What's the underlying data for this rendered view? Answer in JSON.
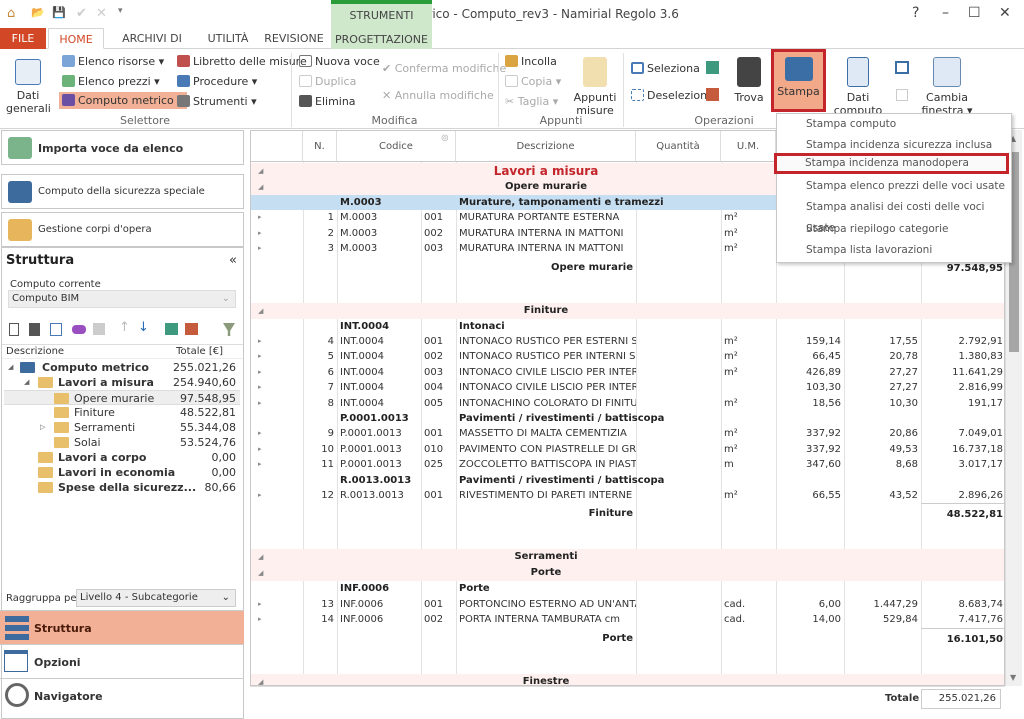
{
  "window": {
    "title": "Computo metrico - Computo_rev3 - Namirial Regolo 3.6",
    "help": "?",
    "minimize": "–",
    "maximize": "☐",
    "close": "✕"
  },
  "qat": {
    "home": "⌂",
    "open": "📂",
    "save": "💾",
    "check": "✔",
    "cancel": "✕",
    "more": "▾"
  },
  "tabs": {
    "file": "FILE",
    "home": "HOME",
    "archivi": "ARCHIVI DI BASE",
    "utilita": "UTILITÀ",
    "revisione": "REVISIONE",
    "context_group": "STRUMENTI",
    "progettazione": "PROGETTAZIONE"
  },
  "ribbon": {
    "dati_generali": "Dati generali",
    "elenco_risorse": "Elenco risorse",
    "elenco_prezzi": "Elenco prezzi",
    "computo_metrico": "Computo metrico",
    "libretto": "Libretto delle misure",
    "procedure": "Procedure",
    "strumenti": "Strumenti",
    "selettore": "Selettore",
    "nuova_voce": "Nuova voce",
    "duplica": "Duplica",
    "elimina": "Elimina",
    "conferma": "Conferma modifiche",
    "annulla": "Annulla modifiche",
    "modifica": "Modifica",
    "incolla": "Incolla",
    "copia": "Copia",
    "taglia": "Taglia",
    "appunti_misure": "Appunti misure",
    "appunti": "Appunti",
    "seleziona": "Seleziona",
    "deseleziona": "Deseleziona",
    "trova": "Trova",
    "stampa": "Stampa",
    "dati_computo": "Dati computo",
    "cambia_finestra": "Cambia finestra",
    "operazioni": "Operazioni",
    "accent": "#d24726",
    "highlight": "#c4252b"
  },
  "stampa_menu": [
    "Stampa computo",
    "Stampa incidenza sicurezza inclusa",
    "Stampa incidenza manodopera",
    "Stampa elenco prezzi delle voci usate",
    "Stampa analisi dei costi delle voci usate",
    "Stampa riepilogo categorie",
    "Stampa lista lavorazioni"
  ],
  "left": {
    "importa": "Importa voce da elenco",
    "sicurezza": "Computo della sicurezza speciale",
    "corpi": "Gestione corpi d'opera",
    "struttura_title": "Struttura",
    "collapse": "«",
    "computo_corrente_label": "Computo corrente",
    "computo_corrente_value": "Computo BIM",
    "tree_header": {
      "descr": "Descrizione",
      "totale": "Totale [€]"
    },
    "tree": [
      {
        "label": "Computo metrico",
        "value": "255.021,26",
        "level": 0,
        "bold": true,
        "exp": "◢"
      },
      {
        "label": "Lavori a misura",
        "value": "254.940,60",
        "level": 1,
        "bold": true,
        "exp": "◢"
      },
      {
        "label": "Opere murarie",
        "value": "97.548,95",
        "level": 2,
        "bold": false,
        "exp": "",
        "selected": true
      },
      {
        "label": "Finiture",
        "value": "48.522,81",
        "level": 2,
        "bold": false,
        "exp": ""
      },
      {
        "label": "Serramenti",
        "value": "55.344,08",
        "level": 2,
        "bold": false,
        "exp": "▷"
      },
      {
        "label": "Solai",
        "value": "53.524,76",
        "level": 2,
        "bold": false,
        "exp": ""
      },
      {
        "label": "Lavori a corpo",
        "value": "0,00",
        "level": 1,
        "bold": true,
        "exp": ""
      },
      {
        "label": "Lavori in economia",
        "value": "0,00",
        "level": 1,
        "bold": true,
        "exp": ""
      },
      {
        "label": "Spese della sicurezz...",
        "value": "80,66",
        "level": 1,
        "bold": true,
        "exp": ""
      }
    ],
    "raggruppa_label": "Raggruppa per",
    "raggruppa_value": "Livello 4 - Subcategorie",
    "nav": [
      "Struttura",
      "Opzioni",
      "Navigatore"
    ]
  },
  "grid": {
    "headers": [
      "",
      "N.",
      "Codice",
      "",
      "Descrizione",
      "Quantità",
      "U.M.",
      "",
      "",
      ""
    ],
    "rows": [
      {
        "k": "g1",
        "desc": "Lavori a misura"
      },
      {
        "k": "g2",
        "desc": "Opere murarie"
      },
      {
        "k": "code",
        "sel": true,
        "code": "M.0003",
        "desc": "Murature, tamponamenti e tramezzi"
      },
      {
        "k": "item",
        "n": "1",
        "code": "M.0003",
        "sub": "001",
        "desc": "MURATURA PORTANTE ESTERNA",
        "um": "m²"
      },
      {
        "k": "item",
        "n": "2",
        "code": "M.0003",
        "sub": "002",
        "desc": "MURATURA INTERNA IN MATTONI",
        "um": "m²"
      },
      {
        "k": "item",
        "n": "3",
        "code": "M.0003",
        "sub": "003",
        "desc": "MURATURA INTERNA IN MATTONI",
        "um": "m²"
      },
      {
        "k": "sub",
        "desc": "Opere murarie",
        "imp": "97.548,95"
      },
      {
        "k": "blank"
      },
      {
        "k": "g2",
        "desc": "Finiture"
      },
      {
        "k": "code",
        "code": "INT.0004",
        "desc": "Intonaci"
      },
      {
        "k": "item",
        "n": "4",
        "code": "INT.0004",
        "sub": "001",
        "desc": "INTONACO RUSTICO PER ESTERNI SU",
        "um": "m²",
        "q": "159,14",
        "p": "17,55",
        "imp": "2.792,91"
      },
      {
        "k": "item",
        "n": "5",
        "code": "INT.0004",
        "sub": "002",
        "desc": "INTONACO RUSTICO PER INTERNI SU",
        "um": "m²",
        "q": "66,45",
        "p": "20,78",
        "imp": "1.380,83"
      },
      {
        "k": "item",
        "n": "6",
        "code": "INT.0004",
        "sub": "003",
        "desc": "INTONACO CIVILE LISCIO PER INTERNI",
        "um": "m²",
        "q": "426,89",
        "p": "27,27",
        "imp": "11.641,29"
      },
      {
        "k": "item",
        "n": "7",
        "code": "INT.0004",
        "sub": "004",
        "desc": "INTONACO CIVILE LISCIO PER INTERNI",
        "um": "",
        "q": "103,30",
        "p": "27,27",
        "imp": "2.816,99"
      },
      {
        "k": "item",
        "n": "8",
        "code": "INT.0004",
        "sub": "005",
        "desc": "INTONACHINO COLORATO DI FINITURA",
        "um": "m²",
        "q": "18,56",
        "p": "10,30",
        "imp": "191,17"
      },
      {
        "k": "code",
        "code": "P.0001.0013",
        "desc": "Pavimenti / rivestimenti / battiscopa"
      },
      {
        "k": "item",
        "n": "9",
        "code": "P.0001.0013",
        "sub": "001",
        "desc": "MASSETTO DI MALTA CEMENTIZIA",
        "um": "m²",
        "q": "337,92",
        "p": "20,86",
        "imp": "7.049,01"
      },
      {
        "k": "item",
        "n": "10",
        "code": "P.0001.0013",
        "sub": "010",
        "desc": "PAVIMENTO CON PIASTRELLE DI GRES",
        "um": "m²",
        "q": "337,92",
        "p": "49,53",
        "imp": "16.737,18"
      },
      {
        "k": "item",
        "n": "11",
        "code": "P.0001.0013",
        "sub": "025",
        "desc": "ZOCCOLETTO BATTISCOPA IN PIASTRELLE",
        "um": "m",
        "q": "347,60",
        "p": "8,68",
        "imp": "3.017,17"
      },
      {
        "k": "code",
        "code": "R.0013.0013",
        "desc": "Pavimenti / rivestimenti / battiscopa"
      },
      {
        "k": "item",
        "n": "12",
        "code": "R.0013.0013",
        "sub": "001",
        "desc": "RIVESTIMENTO DI PARETI INTERNE CON",
        "um": "m²",
        "q": "66,55",
        "p": "43,52",
        "imp": "2.896,26"
      },
      {
        "k": "sub",
        "desc": "Finiture",
        "imp": "48.522,81"
      },
      {
        "k": "blank"
      },
      {
        "k": "g2",
        "desc": "Serramenti"
      },
      {
        "k": "g2",
        "desc": "Porte"
      },
      {
        "k": "code",
        "code": "INF.0006",
        "desc": "Porte"
      },
      {
        "k": "item",
        "n": "13",
        "code": "INF.0006",
        "sub": "001",
        "desc": "PORTONCINO ESTERNO AD UN'ANTA IN",
        "um": "cad.",
        "q": "6,00",
        "p": "1.447,29",
        "imp": "8.683,74"
      },
      {
        "k": "item",
        "n": "14",
        "code": "INF.0006",
        "sub": "002",
        "desc": "PORTA INTERNA TAMBURATA cm",
        "um": "cad.",
        "q": "14,00",
        "p": "529,84",
        "imp": "7.417,76"
      },
      {
        "k": "sub",
        "desc": "Porte",
        "imp": "16.101,50"
      },
      {
        "k": "blank"
      },
      {
        "k": "g2",
        "desc": "Finestre"
      }
    ],
    "totale_label": "Totale",
    "totale_value": "255.021,26"
  }
}
